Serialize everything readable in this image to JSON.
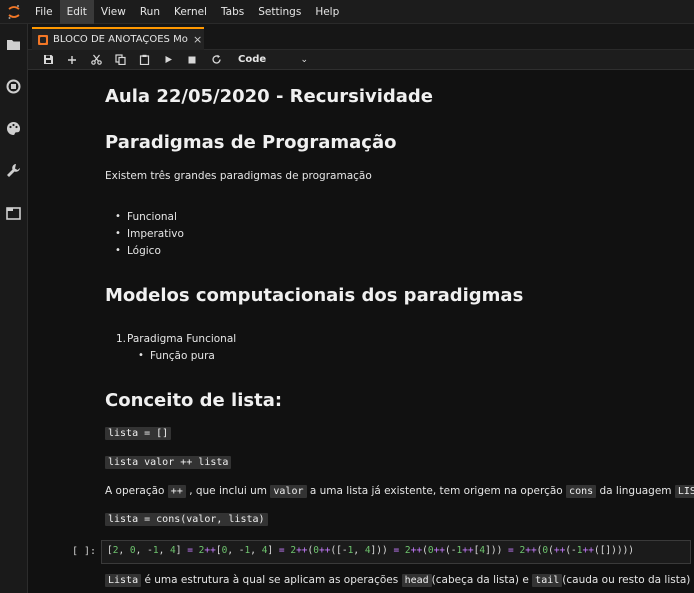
{
  "menubar": {
    "items": [
      "File",
      "Edit",
      "View",
      "Run",
      "Kernel",
      "Tabs",
      "Settings",
      "Help"
    ],
    "active": "Edit"
  },
  "sidebar": {
    "icons": [
      "folder-icon",
      "running-icon",
      "palette-icon",
      "wrench-icon",
      "tabs-icon"
    ]
  },
  "tab": {
    "label": "BLOCO DE ANOTAÇOES Mo",
    "close": "×"
  },
  "toolbar": {
    "cell_type": "Code"
  },
  "notebook": {
    "title": "Aula 22/05/2020 - Recursividade",
    "section1": {
      "heading": "Paradigmas de Programação",
      "intro": "Existem três grandes paradigmas de programação",
      "items": [
        "Funcional",
        "Imperativo",
        "Lógico"
      ]
    },
    "section2": {
      "heading": "Modelos computacionais dos paradigmas",
      "item1_number": "1.",
      "item1": "Paradigma Funcional",
      "sub_item": "Função pura"
    },
    "section3": {
      "heading": "Conceito de lista:",
      "code1": "lista = []",
      "code2": "lista valor ++ lista",
      "para_a": "A operação",
      "para_code_op": "++",
      "para_b": ", que inclui um",
      "para_code_valor": "valor",
      "para_c": "a uma lista já existente, tem origem na operção",
      "para_code_cons": "cons",
      "para_d": "da linguagem",
      "para_code_lisp": "LISP",
      "para_e": ".",
      "code3": "lista = cons(valor, lista)"
    },
    "code_cell": {
      "prompt": "[ ]:",
      "source": "[2, 0, -1, 4] = 2++[0, -1, 4] = 2++(0++([-1, 4])) = 2++(0++(-1++[4])) = 2++(0(++(-1++([]))))"
    },
    "last_line": {
      "code_lista": "Lista",
      "a": "é uma estrutura à qual se aplicam as operações",
      "code_head": "head",
      "b": "(cabeça da lista) e",
      "code_tail": "tail",
      "c": "(cauda ou resto da lista)"
    }
  }
}
